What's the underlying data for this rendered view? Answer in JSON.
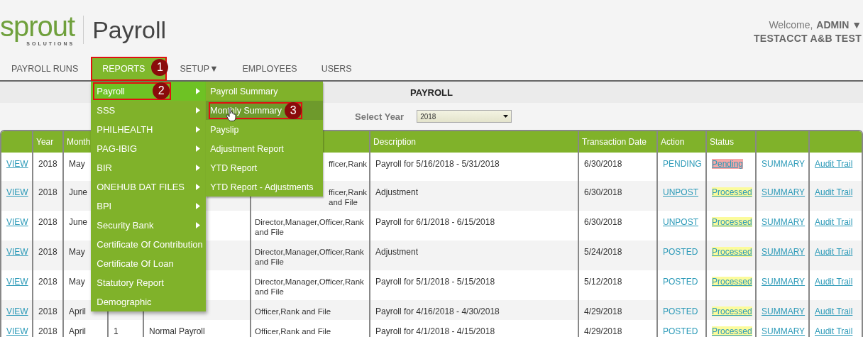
{
  "header": {
    "logo": {
      "wordmark": "sprout",
      "tagline": "SOLUTIONS"
    },
    "app_title": "Payroll",
    "welcome": "Welcome,",
    "user": "ADMIN",
    "user_caret": "▼",
    "company": "TESTACCT A&B TEST"
  },
  "nav": [
    {
      "label": "PAYROLL RUNS",
      "selected": false
    },
    {
      "label": "REPORTS",
      "selected": true,
      "callout": "1"
    },
    {
      "label": "SETUP",
      "selected": false,
      "caret": "▼"
    },
    {
      "label": "EMPLOYEES",
      "selected": false
    },
    {
      "label": "USERS",
      "selected": false
    }
  ],
  "reports_menu": {
    "items": [
      {
        "label": "Payroll",
        "has_submenu": true,
        "highlighted": true,
        "callout": "2"
      },
      {
        "label": "SSS",
        "has_submenu": true,
        "highlighted": false
      },
      {
        "label": "PHILHEALTH",
        "has_submenu": true,
        "highlighted": false
      },
      {
        "label": "PAG-IBIG",
        "has_submenu": true,
        "highlighted": false
      },
      {
        "label": "BIR",
        "has_submenu": true,
        "highlighted": false
      },
      {
        "label": "ONEHUB DAT FILES",
        "has_submenu": true,
        "highlighted": false
      },
      {
        "label": "BPI",
        "has_submenu": true,
        "highlighted": false
      },
      {
        "label": "Security Bank",
        "has_submenu": true,
        "highlighted": false
      },
      {
        "label": "Certificate Of Contribution",
        "has_submenu": false,
        "highlighted": false
      },
      {
        "label": "Certificate Of Loan",
        "has_submenu": false,
        "highlighted": false
      },
      {
        "label": "Statutory Report",
        "has_submenu": false,
        "highlighted": false
      },
      {
        "label": "Demographic",
        "has_submenu": false,
        "highlighted": false
      }
    ],
    "submenu": [
      {
        "label": "Payroll Summary",
        "highlighted": false
      },
      {
        "label": "Monthly Summary",
        "highlighted": true,
        "callout": "3"
      },
      {
        "label": "Payslip",
        "highlighted": false
      },
      {
        "label": "Adjustment Report",
        "highlighted": false
      },
      {
        "label": "YTD Report",
        "highlighted": false
      },
      {
        "label": "YTD Report - Adjustments",
        "highlighted": false
      }
    ]
  },
  "section_title": "PAYROLL",
  "year_filter": {
    "label": "Select Year",
    "value": "2018"
  },
  "table": {
    "columns": [
      {
        "kind": "blank"
      },
      {
        "kind": "text",
        "label": "Year"
      },
      {
        "kind": "text",
        "label": "Month"
      },
      {
        "kind": "blank"
      },
      {
        "kind": "blank"
      },
      {
        "kind": "blank"
      },
      {
        "kind": "text",
        "label": "Description"
      },
      {
        "kind": "text",
        "label": "Transaction Date"
      },
      {
        "kind": "text",
        "label": "Action"
      },
      {
        "kind": "text",
        "label": "Status"
      },
      {
        "kind": "blank"
      },
      {
        "kind": "blank"
      }
    ],
    "rows": [
      {
        "view": "VIEW",
        "year": "2018",
        "month": "May",
        "column_6": "fficer,Rank",
        "column_6_covered": true,
        "description": "Payroll for 5/16/2018 - 5/31/2018",
        "date": "6/30/2018",
        "action": "PENDING",
        "action_link": false,
        "status": {
          "text": "Pending",
          "color": "#f4a7a7"
        },
        "summary": "SUMMARY",
        "summary_link": false,
        "audit": "Audit Trail"
      },
      {
        "view": "VIEW",
        "year": "2018",
        "month": "June",
        "column_6": "fficer,Rank and File",
        "column_6_covered": true,
        "description": "Adjustment",
        "date": "6/30/2018",
        "action": "UNPOST",
        "action_link": true,
        "status": {
          "text": "Processed",
          "color": "#fbfb9c"
        },
        "summary": "SUMMARY",
        "summary_link": true,
        "audit": "Audit Trail"
      },
      {
        "view": "VIEW",
        "year": "2018",
        "month": "June",
        "column_6": "Director,Manager,Officer,Rank and File",
        "column_6_covered": false,
        "description": "Payroll for 6/1/2018 - 6/15/2018",
        "date": "6/30/2018",
        "action": "UNPOST",
        "action_link": true,
        "status": {
          "text": "Processed",
          "color": "#fbfb9c"
        },
        "summary": "SUMMARY",
        "summary_link": true,
        "audit": "Audit Trail"
      },
      {
        "view": "VIEW",
        "year": "2018",
        "month": "May",
        "column_6": "Director,Manager,Officer,Rank and File",
        "column_6_covered": false,
        "description": "Adjustment",
        "date": "5/24/2018",
        "action": "POSTED",
        "action_link": false,
        "status": {
          "text": "Processed",
          "color": "#fbfb9c"
        },
        "summary": "SUMMARY",
        "summary_link": true,
        "audit": "Audit Trail"
      },
      {
        "view": "VIEW",
        "year": "2018",
        "month": "May",
        "column_6": "Director,Manager,Officer,Rank and File",
        "column_6_covered": false,
        "description": "Payroll for 5/1/2018 - 5/15/2018",
        "date": "5/12/2018",
        "action": "POSTED",
        "action_link": false,
        "status": {
          "text": "Processed",
          "color": "#fbfb9c"
        },
        "summary": "SUMMARY",
        "summary_link": true,
        "audit": "Audit Trail"
      },
      {
        "view": "VIEW",
        "year": "2018",
        "month": "April",
        "column_6": "Officer,Rank and File",
        "column_6_covered": false,
        "description": "Payroll for 4/16/2018 - 4/30/2018",
        "date": "4/29/2018",
        "action": "POSTED",
        "action_link": false,
        "status": {
          "text": "Processed",
          "color": "#fbfb9c"
        },
        "summary": "SUMMARY",
        "summary_link": true,
        "audit": "Audit Trail"
      },
      {
        "view": "VIEW",
        "year": "2018",
        "month": "April",
        "column_4": "1",
        "column_5": "Normal Payroll",
        "column_6": "Officer,Rank and File",
        "column_6_covered": false,
        "description": "Payroll for 4/1/2018 - 4/15/2018",
        "date": "4/29/2018",
        "action": "POSTED",
        "action_link": false,
        "status": {
          "text": "Processed",
          "color": "#fbfb9c"
        },
        "summary": "SUMMARY",
        "summary_link": true,
        "audit": "Audit Trail"
      }
    ]
  }
}
